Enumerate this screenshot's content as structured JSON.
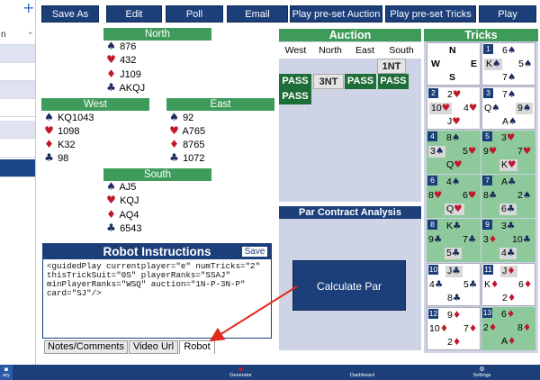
{
  "left_panel": {
    "row_text": "n",
    "plus": "+",
    "chevron": "⌄"
  },
  "toolbar": {
    "save_as": "Save As",
    "edit": "Edit",
    "poll": "Poll",
    "email": "Email",
    "play_auction": "Play pre-set Auction",
    "play_tricks": "Play pre-set Tricks",
    "play": "Play"
  },
  "colors": {
    "accent_blue": "#1c3f7a",
    "header_green": "#3f9b5a",
    "pass_green": "#1f6d37",
    "trick_green": "#8ec99b",
    "panel_lavender": "#cfd3e6",
    "red_suit": "#c0182b"
  },
  "hands": {
    "north": {
      "label": "North",
      "spades": "876",
      "hearts": "432",
      "diamonds": "J109",
      "clubs": "AKQJ"
    },
    "west": {
      "label": "West",
      "spades": "KQ1043",
      "hearts": "1098",
      "diamonds": "K32",
      "clubs": "98"
    },
    "east": {
      "label": "East",
      "spades": "92",
      "hearts": "A765",
      "diamonds": "8765",
      "clubs": "1072"
    },
    "south": {
      "label": "South",
      "spades": "AJ5",
      "hearts": "KQJ",
      "diamonds": "AQ4",
      "clubs": "6543"
    }
  },
  "suits": {
    "spades": "♠",
    "hearts": "♥",
    "diamonds": "♦",
    "clubs": "♣"
  },
  "auction": {
    "title": "Auction",
    "headers": [
      "West",
      "North",
      "East",
      "South"
    ],
    "bids": [
      "1NT",
      "PASS",
      "3NT",
      "PASS",
      "PASS",
      "PASS"
    ]
  },
  "par": {
    "title": "Par Contract Analysis",
    "button": "Calculate Par"
  },
  "tricks": {
    "title": "Tricks",
    "compass": {
      "n": "N",
      "w": "W",
      "e": "E",
      "s": "S"
    },
    "items": [
      {
        "num": "1",
        "top": "6♠",
        "left": "K♠",
        "right": "5♠",
        "bottom": "7♠"
      },
      {
        "num": "2",
        "top": "2♥",
        "left": "10♥",
        "right": "4♥",
        "bottom": "J♥"
      },
      {
        "num": "3",
        "top": "7♠",
        "left": "Q♠",
        "right": "9♠",
        "bottom": "A♠"
      },
      {
        "num": "4",
        "top": "8♠",
        "left": "3♠",
        "right": "5♥",
        "bottom": "Q♥"
      },
      {
        "num": "5",
        "top": "3♥",
        "left": "9♥",
        "right": "7♥",
        "bottom": "K♥"
      },
      {
        "num": "6",
        "top": "4♠",
        "left": "8♥",
        "right": "6♥",
        "bottom": "Q♥"
      },
      {
        "num": "7",
        "top": "A♣",
        "left": "8♣",
        "right": "2♠",
        "bottom": "6♣"
      },
      {
        "num": "8",
        "top": "K♣",
        "left": "9♣",
        "right": "7♣",
        "bottom": "5♣"
      },
      {
        "num": "9",
        "top": "3♣",
        "left": "3♦",
        "right": "10♣",
        "bottom": "4♣"
      },
      {
        "num": "10",
        "top": "J♣",
        "left": "4♣",
        "right": "5♣",
        "bottom": "8♣"
      },
      {
        "num": "11",
        "top": "J♦",
        "left": "K♦",
        "right": "6♦",
        "bottom": "2♦"
      },
      {
        "num": "12",
        "top": "9♦",
        "left": "10♦",
        "right": "7♦",
        "bottom": "2♦"
      },
      {
        "num": "13",
        "top": "6♦",
        "left": "2♦",
        "right": "8♦",
        "bottom": "A♦"
      }
    ]
  },
  "robot": {
    "title": "Robot Instructions",
    "save": "Save",
    "text": "<guidedPlay currentplayer=\"e\" numTricks=\"2\"\nthisTrickSuit=\"0S\" playerRanks=\"SSAJ\"\nminPlayerRanks=\"WSQ\" auction=\"1N-P-3N-P\"\ncard=\"SJ\"/>",
    "tabs": [
      "Notes/Comments",
      "Video Url",
      "Robot"
    ]
  },
  "bottom_nav": {
    "diary": "ary",
    "generator": "Generator",
    "dashboard": "Dashboard",
    "settings": "Settings"
  }
}
